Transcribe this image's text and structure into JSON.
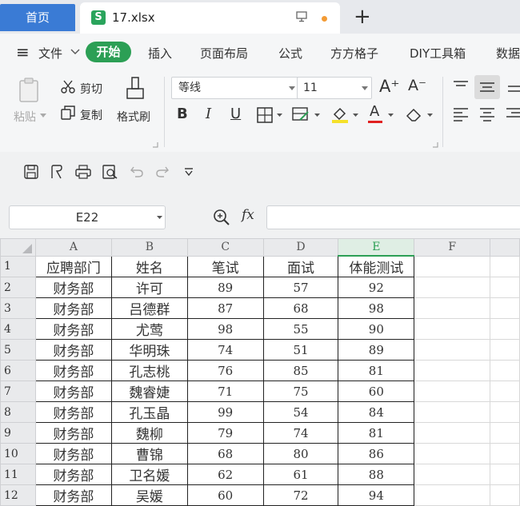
{
  "titlebar": {
    "home_tab": "首页",
    "file_icon": "S",
    "file_name": "17.xlsx",
    "new_tab": "+"
  },
  "menu": {
    "hamburger": "≡",
    "file": "文件",
    "start": "开始",
    "items": [
      "插入",
      "页面布局",
      "公式",
      "方方格子",
      "DIY工具箱",
      "数据"
    ]
  },
  "ribbon": {
    "paste": "粘贴",
    "cut": "剪切",
    "copy": "复制",
    "format_painter": "格式刷",
    "font_name": "等线",
    "font_size": "11",
    "bold": "B",
    "italic": "I",
    "underline": "U",
    "grow_font": "A⁺",
    "shrink_font": "A⁻",
    "font_color_letter": "A"
  },
  "formula_bar": {
    "cell_ref": "E22",
    "fx": "fx",
    "value": ""
  },
  "sheet": {
    "columns": [
      "A",
      "B",
      "C",
      "D",
      "E",
      "F"
    ],
    "selected_column": "E",
    "rows": [
      {
        "n": "1",
        "cells": [
          "应聘部门",
          "姓名",
          "笔试",
          "面试",
          "体能测试"
        ]
      },
      {
        "n": "2",
        "cells": [
          "财务部",
          "许可",
          "89",
          "57",
          "92"
        ]
      },
      {
        "n": "3",
        "cells": [
          "财务部",
          "吕德群",
          "87",
          "68",
          "98"
        ]
      },
      {
        "n": "4",
        "cells": [
          "财务部",
          "尤莺",
          "98",
          "55",
          "90"
        ]
      },
      {
        "n": "5",
        "cells": [
          "财务部",
          "华明珠",
          "74",
          "51",
          "89"
        ]
      },
      {
        "n": "6",
        "cells": [
          "财务部",
          "孔志桃",
          "76",
          "85",
          "81"
        ]
      },
      {
        "n": "7",
        "cells": [
          "财务部",
          "魏睿婕",
          "71",
          "75",
          "60"
        ]
      },
      {
        "n": "8",
        "cells": [
          "财务部",
          "孔玉晶",
          "99",
          "54",
          "84"
        ]
      },
      {
        "n": "9",
        "cells": [
          "财务部",
          "魏柳",
          "79",
          "74",
          "81"
        ]
      },
      {
        "n": "10",
        "cells": [
          "财务部",
          "曹锦",
          "68",
          "80",
          "86"
        ]
      },
      {
        "n": "11",
        "cells": [
          "财务部",
          "卫名媛",
          "62",
          "61",
          "88"
        ]
      },
      {
        "n": "12",
        "cells": [
          "财务部",
          "吴媛",
          "60",
          "72",
          "94"
        ]
      }
    ]
  },
  "colors": {
    "accent_green": "#2c9f55",
    "home_tab_blue": "#3a7bd5",
    "toolbar_bg": "#f5f6f7",
    "font_color_red": "#e02020",
    "fill_color_yellow": "#f5e12b"
  }
}
